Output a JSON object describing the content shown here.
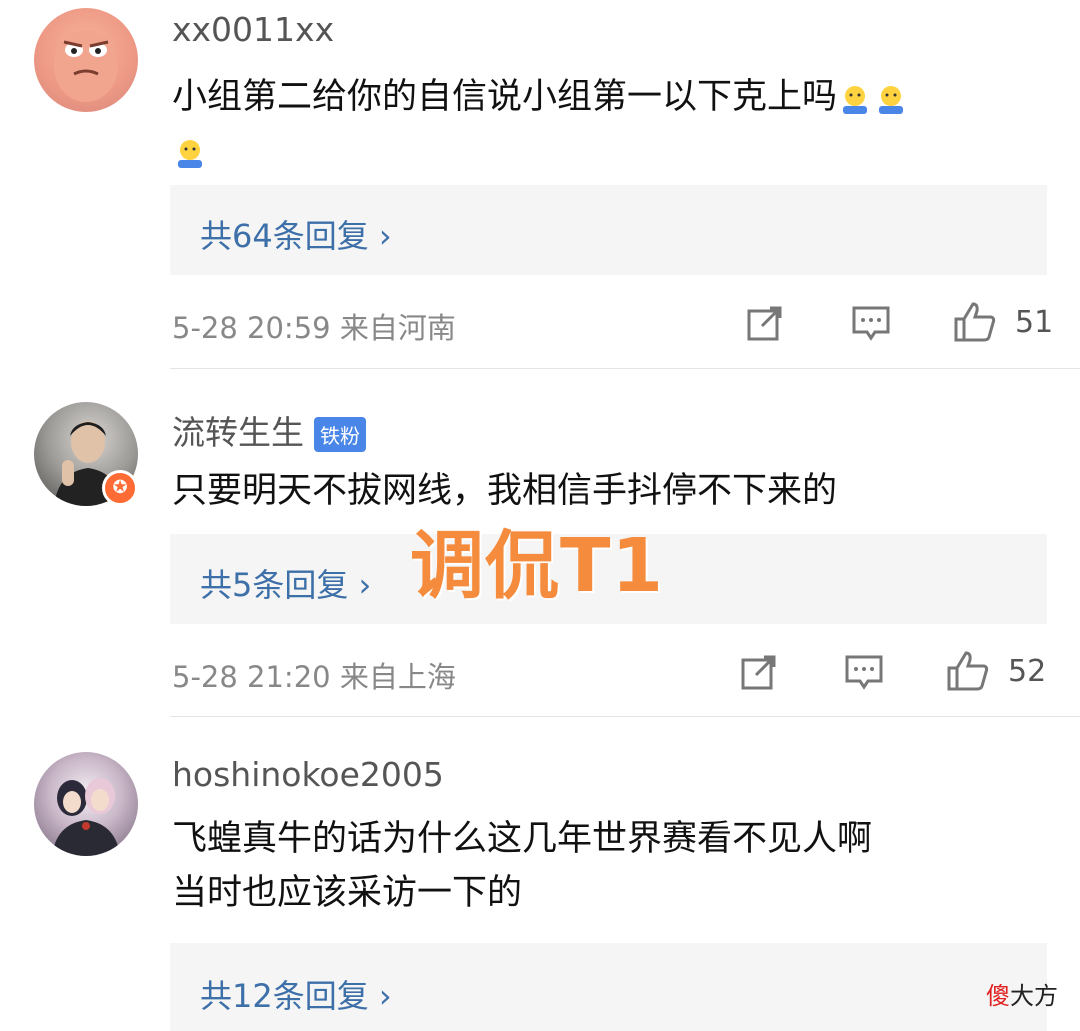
{
  "comments": [
    {
      "username": "xx0011xx",
      "text": "小组第二给你的自信说小组第一以下克上吗",
      "replies_label": "共64条回复",
      "meta": "5-28 20:59  来自河南",
      "likes": "51"
    },
    {
      "username": "流转生生",
      "tag": "铁粉",
      "text": "只要明天不拔网线，我相信手抖停不下来的",
      "replies_label": "共5条回复",
      "meta": "5-28 21:20  来自上海",
      "likes": "52"
    },
    {
      "username": "hoshinokoe2005",
      "text_line1": "飞蝗真牛的话为什么这几年世界赛看不见人啊",
      "text_line2": "当时也应该采访一下的",
      "replies_label": "共12条回复"
    }
  ],
  "overlay_text": "调侃T1",
  "watermark": {
    "red": "傻",
    "rest": "大方"
  },
  "colors": {
    "reply_link": "#3d6fa8",
    "stamp": "#f58b3c",
    "badge": "#4a86e8"
  }
}
